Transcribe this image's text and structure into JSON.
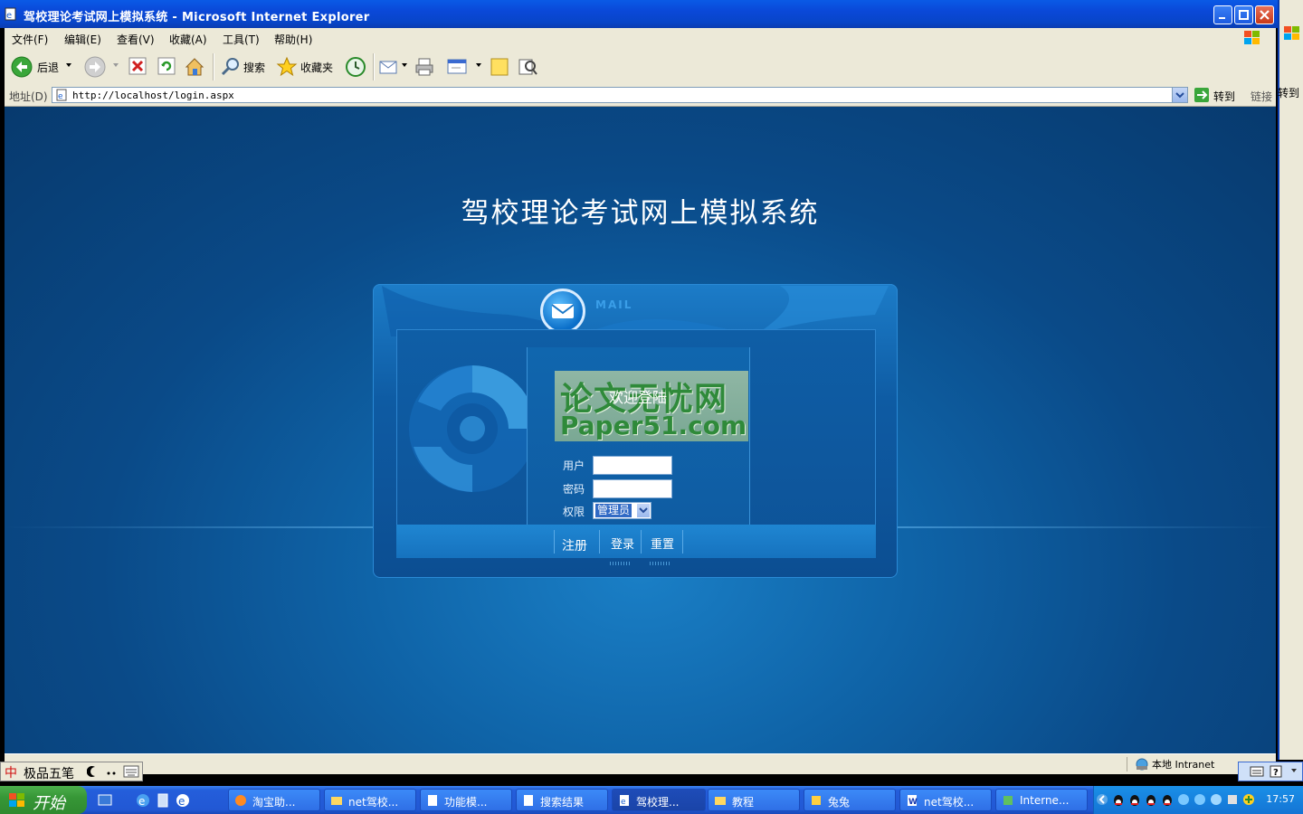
{
  "window": {
    "title": "驾校理论考试网上模拟系统 - Microsoft Internet Explorer"
  },
  "menubar": {
    "items": [
      "文件(F)",
      "编辑(E)",
      "查看(V)",
      "收藏(A)",
      "工具(T)",
      "帮助(H)"
    ]
  },
  "toolbar": {
    "back_label": "后退",
    "search_label": "搜索",
    "favorites_label": "收藏夹"
  },
  "addressbar": {
    "label": "地址(D)",
    "url": "http://localhost/login.aspx",
    "go_label": "转到",
    "links_label": "链接",
    "overflow_label": "转到"
  },
  "page": {
    "title": "驾校理论考试网上模拟系统",
    "mail_label": "MAIL",
    "watermark_line1": "论文无忧网",
    "watermark_line2": "Paper51.com",
    "welcome": "欢迎登陆",
    "form": {
      "user_label": "用户",
      "password_label": "密码",
      "role_label": "权限",
      "user_value": "",
      "password_value": "",
      "role_value": "管理员"
    },
    "buttons": {
      "register": "注册",
      "login": "登录",
      "reset": "重置"
    }
  },
  "statusbar": {
    "zone": "本地 Intranet"
  },
  "ime": {
    "name": "极品五笔"
  },
  "taskbar": {
    "start_label": "开始",
    "tasks": [
      {
        "label": "淘宝助..."
      },
      {
        "label": "net驾校..."
      },
      {
        "label": "功能模..."
      },
      {
        "label": "搜索结果"
      },
      {
        "label": "驾校理..."
      },
      {
        "label": "教程"
      },
      {
        "label": "兔兔"
      },
      {
        "label": "net驾校..."
      },
      {
        "label": "Interne..."
      }
    ],
    "clock": "17:57"
  }
}
